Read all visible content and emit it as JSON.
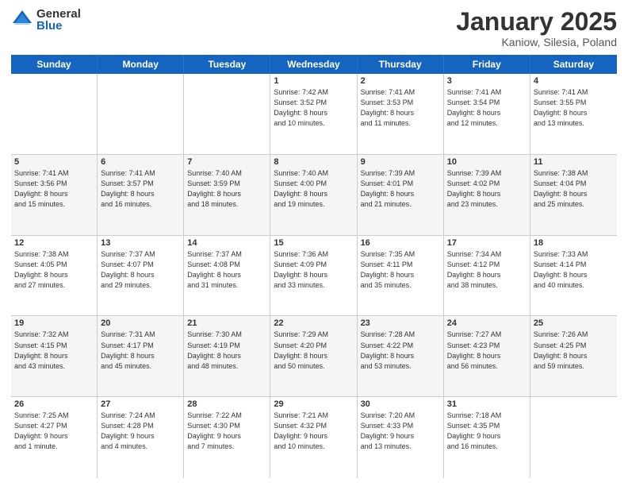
{
  "header": {
    "logo_general": "General",
    "logo_blue": "Blue",
    "month_title": "January 2025",
    "location": "Kaniow, Silesia, Poland"
  },
  "days_of_week": [
    "Sunday",
    "Monday",
    "Tuesday",
    "Wednesday",
    "Thursday",
    "Friday",
    "Saturday"
  ],
  "weeks": [
    {
      "alt": false,
      "cells": [
        {
          "day": "",
          "text": ""
        },
        {
          "day": "",
          "text": ""
        },
        {
          "day": "",
          "text": ""
        },
        {
          "day": "1",
          "text": "Sunrise: 7:42 AM\nSunset: 3:52 PM\nDaylight: 8 hours\nand 10 minutes."
        },
        {
          "day": "2",
          "text": "Sunrise: 7:41 AM\nSunset: 3:53 PM\nDaylight: 8 hours\nand 11 minutes."
        },
        {
          "day": "3",
          "text": "Sunrise: 7:41 AM\nSunset: 3:54 PM\nDaylight: 8 hours\nand 12 minutes."
        },
        {
          "day": "4",
          "text": "Sunrise: 7:41 AM\nSunset: 3:55 PM\nDaylight: 8 hours\nand 13 minutes."
        }
      ]
    },
    {
      "alt": true,
      "cells": [
        {
          "day": "5",
          "text": "Sunrise: 7:41 AM\nSunset: 3:56 PM\nDaylight: 8 hours\nand 15 minutes."
        },
        {
          "day": "6",
          "text": "Sunrise: 7:41 AM\nSunset: 3:57 PM\nDaylight: 8 hours\nand 16 minutes."
        },
        {
          "day": "7",
          "text": "Sunrise: 7:40 AM\nSunset: 3:59 PM\nDaylight: 8 hours\nand 18 minutes."
        },
        {
          "day": "8",
          "text": "Sunrise: 7:40 AM\nSunset: 4:00 PM\nDaylight: 8 hours\nand 19 minutes."
        },
        {
          "day": "9",
          "text": "Sunrise: 7:39 AM\nSunset: 4:01 PM\nDaylight: 8 hours\nand 21 minutes."
        },
        {
          "day": "10",
          "text": "Sunrise: 7:39 AM\nSunset: 4:02 PM\nDaylight: 8 hours\nand 23 minutes."
        },
        {
          "day": "11",
          "text": "Sunrise: 7:38 AM\nSunset: 4:04 PM\nDaylight: 8 hours\nand 25 minutes."
        }
      ]
    },
    {
      "alt": false,
      "cells": [
        {
          "day": "12",
          "text": "Sunrise: 7:38 AM\nSunset: 4:05 PM\nDaylight: 8 hours\nand 27 minutes."
        },
        {
          "day": "13",
          "text": "Sunrise: 7:37 AM\nSunset: 4:07 PM\nDaylight: 8 hours\nand 29 minutes."
        },
        {
          "day": "14",
          "text": "Sunrise: 7:37 AM\nSunset: 4:08 PM\nDaylight: 8 hours\nand 31 minutes."
        },
        {
          "day": "15",
          "text": "Sunrise: 7:36 AM\nSunset: 4:09 PM\nDaylight: 8 hours\nand 33 minutes."
        },
        {
          "day": "16",
          "text": "Sunrise: 7:35 AM\nSunset: 4:11 PM\nDaylight: 8 hours\nand 35 minutes."
        },
        {
          "day": "17",
          "text": "Sunrise: 7:34 AM\nSunset: 4:12 PM\nDaylight: 8 hours\nand 38 minutes."
        },
        {
          "day": "18",
          "text": "Sunrise: 7:33 AM\nSunset: 4:14 PM\nDaylight: 8 hours\nand 40 minutes."
        }
      ]
    },
    {
      "alt": true,
      "cells": [
        {
          "day": "19",
          "text": "Sunrise: 7:32 AM\nSunset: 4:15 PM\nDaylight: 8 hours\nand 43 minutes."
        },
        {
          "day": "20",
          "text": "Sunrise: 7:31 AM\nSunset: 4:17 PM\nDaylight: 8 hours\nand 45 minutes."
        },
        {
          "day": "21",
          "text": "Sunrise: 7:30 AM\nSunset: 4:19 PM\nDaylight: 8 hours\nand 48 minutes."
        },
        {
          "day": "22",
          "text": "Sunrise: 7:29 AM\nSunset: 4:20 PM\nDaylight: 8 hours\nand 50 minutes."
        },
        {
          "day": "23",
          "text": "Sunrise: 7:28 AM\nSunset: 4:22 PM\nDaylight: 8 hours\nand 53 minutes."
        },
        {
          "day": "24",
          "text": "Sunrise: 7:27 AM\nSunset: 4:23 PM\nDaylight: 8 hours\nand 56 minutes."
        },
        {
          "day": "25",
          "text": "Sunrise: 7:26 AM\nSunset: 4:25 PM\nDaylight: 8 hours\nand 59 minutes."
        }
      ]
    },
    {
      "alt": false,
      "cells": [
        {
          "day": "26",
          "text": "Sunrise: 7:25 AM\nSunset: 4:27 PM\nDaylight: 9 hours\nand 1 minute."
        },
        {
          "day": "27",
          "text": "Sunrise: 7:24 AM\nSunset: 4:28 PM\nDaylight: 9 hours\nand 4 minutes."
        },
        {
          "day": "28",
          "text": "Sunrise: 7:22 AM\nSunset: 4:30 PM\nDaylight: 9 hours\nand 7 minutes."
        },
        {
          "day": "29",
          "text": "Sunrise: 7:21 AM\nSunset: 4:32 PM\nDaylight: 9 hours\nand 10 minutes."
        },
        {
          "day": "30",
          "text": "Sunrise: 7:20 AM\nSunset: 4:33 PM\nDaylight: 9 hours\nand 13 minutes."
        },
        {
          "day": "31",
          "text": "Sunrise: 7:18 AM\nSunset: 4:35 PM\nDaylight: 9 hours\nand 16 minutes."
        },
        {
          "day": "",
          "text": ""
        }
      ]
    }
  ]
}
